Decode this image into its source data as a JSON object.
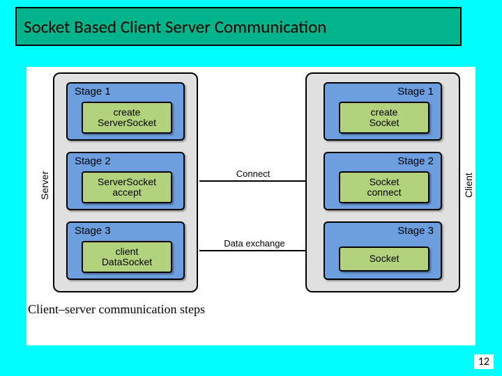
{
  "title": "Socket Based Client Server Communication",
  "server": {
    "vlabel": "Server",
    "stages": [
      {
        "label": "Stage 1",
        "block_lines": [
          "create",
          "ServerSocket"
        ]
      },
      {
        "label": "Stage 2",
        "block_lines": [
          "ServerSocket",
          "accept"
        ]
      },
      {
        "label": "Stage 3",
        "block_lines": [
          "client",
          "DataSocket"
        ]
      }
    ]
  },
  "client": {
    "vlabel": "Client",
    "stages": [
      {
        "label": "Stage 1",
        "block_lines": [
          "create",
          "Socket"
        ]
      },
      {
        "label": "Stage 2",
        "block_lines": [
          "Socket",
          "connect"
        ]
      },
      {
        "label": "Stage 3",
        "block_lines": [
          "Socket"
        ]
      }
    ]
  },
  "connectors": [
    {
      "label": "Connect"
    },
    {
      "label": "Data exchange"
    }
  ],
  "caption": "Client–server communication steps",
  "page_number": "12"
}
